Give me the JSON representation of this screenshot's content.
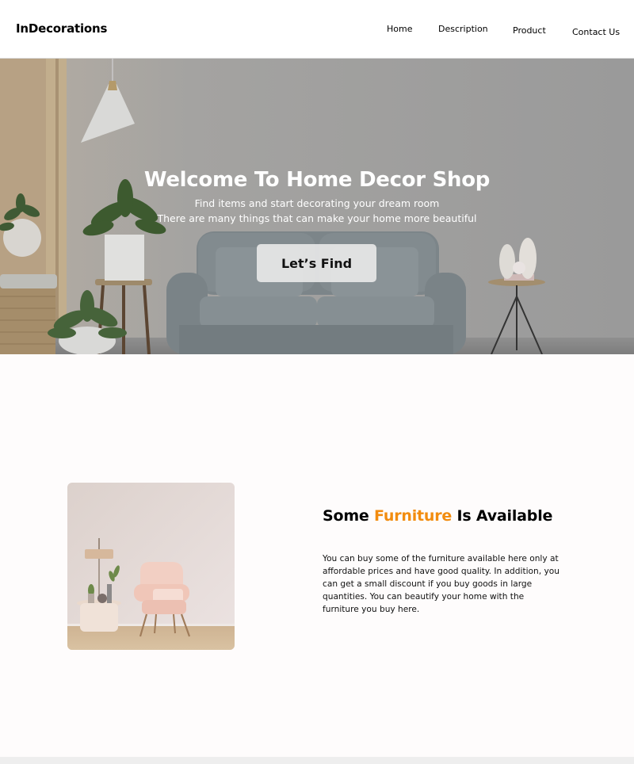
{
  "header": {
    "logo": "InDecorations",
    "nav": {
      "home": "Home",
      "description": "Description",
      "product": "Product",
      "contact": "Contact Us"
    }
  },
  "hero": {
    "title": "Welcome To Home Decor Shop",
    "subtitle_line1": "Find items and start decorating your dream room",
    "subtitle_line2": "There are many things that can make your home more beautiful",
    "cta_label": "Let’s Find"
  },
  "feature": {
    "title_prefix": "Some",
    "title_accent": "Furniture",
    "title_suffix": "Is Available",
    "body": "You can buy some of the furniture available here only at affordable prices and have good quality. In addition, you can get a small discount if you buy goods in large quantities. You can beautify your home with the furniture you buy here.",
    "accent_color": "#f28c0f"
  }
}
